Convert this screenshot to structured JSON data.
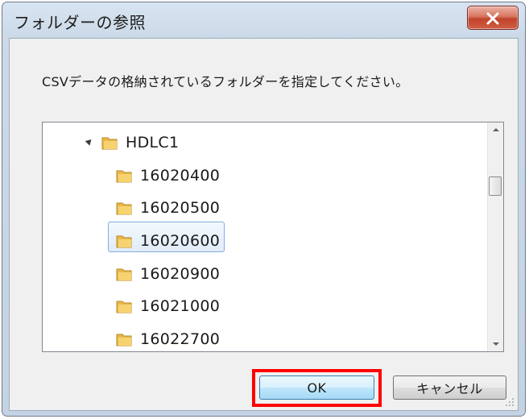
{
  "window": {
    "title": "フォルダーの参照",
    "close_icon": "close-x-icon"
  },
  "instruction": "CSVデータの格納されているフォルダーを指定してください。",
  "tree": {
    "root": {
      "label": "HDLC1",
      "expanded": true,
      "icon": "folder-icon"
    },
    "children": [
      {
        "label": "16020400",
        "selected": false
      },
      {
        "label": "16020500",
        "selected": false
      },
      {
        "label": "16020600",
        "selected": true
      },
      {
        "label": "16020900",
        "selected": false
      },
      {
        "label": "16021000",
        "selected": false
      },
      {
        "label": "16022700",
        "selected": false
      }
    ]
  },
  "buttons": {
    "ok_label": "OK",
    "cancel_label": "キャンセル"
  },
  "colors": {
    "highlight": "#ff0000",
    "selection": "#84acdd",
    "close_button": "#c1432c"
  }
}
